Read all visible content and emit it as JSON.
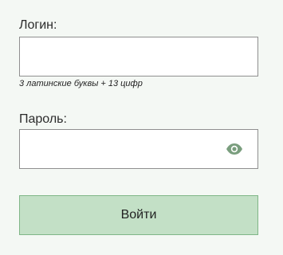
{
  "form": {
    "login": {
      "label": "Логин:",
      "value": "",
      "placeholder": "",
      "hint": "3 латинские буквы + 13 цифр"
    },
    "password": {
      "label": "Пароль:",
      "value": "",
      "placeholder": "",
      "toggle_icon": "eye-icon"
    },
    "submit_label": "Войти"
  },
  "colors": {
    "background": "#f4f8f4",
    "button_bg": "#c3e0c6",
    "button_border": "#7fb687",
    "icon": "#7a9e7e"
  }
}
